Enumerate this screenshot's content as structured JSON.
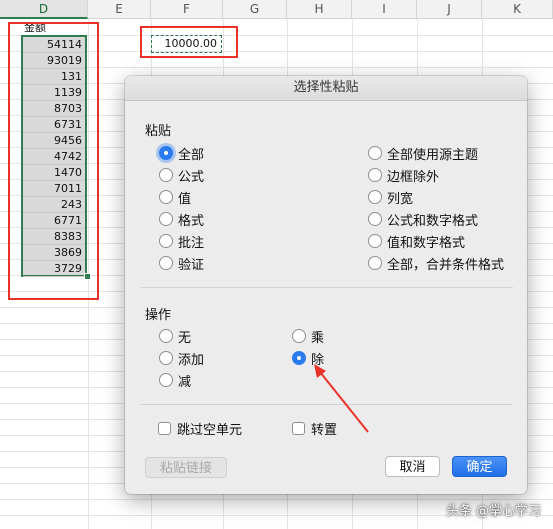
{
  "columns": [
    "D",
    "E",
    "F",
    "G",
    "H",
    "I",
    "J",
    "K"
  ],
  "sheet": {
    "amount_label": "金额",
    "amounts": [
      "54114",
      "93019",
      "131",
      "1139",
      "8703",
      "6731",
      "9456",
      "4742",
      "1470",
      "7011",
      "243",
      "6771",
      "8383",
      "3869",
      "3729"
    ],
    "copied_value": "10000.00"
  },
  "dialog": {
    "title": "选择性粘贴",
    "paste_section": "粘贴",
    "paste_left": [
      "全部",
      "公式",
      "值",
      "格式",
      "批注",
      "验证"
    ],
    "paste_right": [
      "全部使用源主题",
      "边框除外",
      "列宽",
      "公式和数字格式",
      "值和数字格式",
      "全部，合并条件格式"
    ],
    "paste_selected": "全部",
    "operation_section": "操作",
    "op_left": [
      "无",
      "添加",
      "减"
    ],
    "op_right": [
      "乘",
      "除"
    ],
    "op_selected": "除",
    "skip_blanks": "跳过空单元",
    "transpose": "转置",
    "paste_link_button": "粘贴链接",
    "cancel_button": "取消",
    "ok_button": "确定"
  },
  "colors": {
    "accent": "#2a7bf0",
    "annotation": "#e8322a",
    "selection": "#2e7d4f"
  },
  "watermark": "头条 @掌心学习"
}
